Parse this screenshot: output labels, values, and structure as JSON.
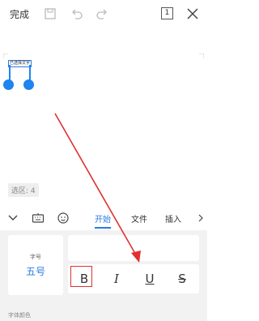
{
  "topbar": {
    "done_label": "完成",
    "page_count": "1"
  },
  "document": {
    "selected_text": "已选择文字",
    "selection_count": "选区: 4"
  },
  "toolbar": {
    "tabs": [
      {
        "label": "开始",
        "active": true
      },
      {
        "label": "文件",
        "active": false
      },
      {
        "label": "插入",
        "active": false
      }
    ]
  },
  "format_panel": {
    "font_size_label": "字号",
    "font_size_value": "五号",
    "bold_label": "B",
    "italic_label": "I",
    "underline_label": "U",
    "strike_label": "S",
    "font_color_label": "字体颜色"
  },
  "colors": {
    "accent": "#2a7be4",
    "selection_handle": "#1e84f0",
    "highlight_box": "#e03030",
    "arrow": "#e03030"
  }
}
